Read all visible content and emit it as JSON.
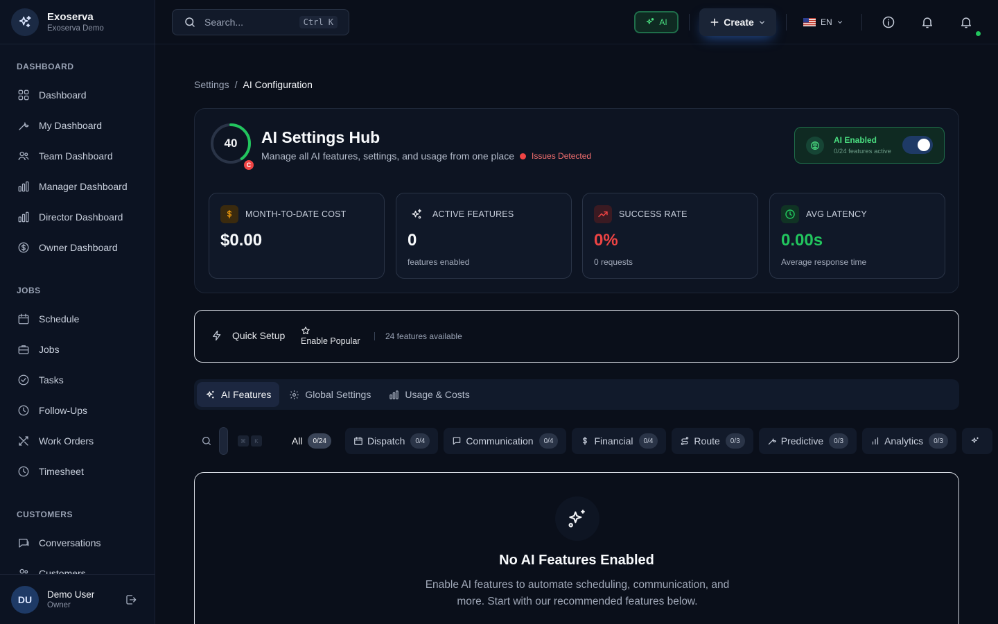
{
  "brand": {
    "name": "Exoserva",
    "subtitle": "Exoserva Demo"
  },
  "sidebar": {
    "sections": [
      {
        "title": "DASHBOARD",
        "items": [
          {
            "label": "Dashboard",
            "icon": "grid-icon"
          },
          {
            "label": "My Dashboard",
            "icon": "wrench-icon"
          },
          {
            "label": "Team Dashboard",
            "icon": "users-icon"
          },
          {
            "label": "Manager Dashboard",
            "icon": "bar-chart-icon"
          },
          {
            "label": "Director Dashboard",
            "icon": "bar-chart-icon"
          },
          {
            "label": "Owner Dashboard",
            "icon": "dollar-circle-icon"
          }
        ]
      },
      {
        "title": "JOBS",
        "items": [
          {
            "label": "Schedule",
            "icon": "calendar-icon"
          },
          {
            "label": "Jobs",
            "icon": "briefcase-icon"
          },
          {
            "label": "Tasks",
            "icon": "check-circle-icon"
          },
          {
            "label": "Follow-Ups",
            "icon": "clock-icon"
          },
          {
            "label": "Work Orders",
            "icon": "tools-icon"
          },
          {
            "label": "Timesheet",
            "icon": "clock-icon"
          }
        ]
      },
      {
        "title": "CUSTOMERS",
        "items": [
          {
            "label": "Conversations",
            "icon": "chat-icon"
          },
          {
            "label": "Customers",
            "icon": "users-icon"
          }
        ]
      }
    ]
  },
  "user": {
    "initials": "DU",
    "name": "Demo User",
    "role": "Owner"
  },
  "topbar": {
    "search_placeholder": "Search...",
    "search_shortcut": "Ctrl K",
    "ai_label": "AI",
    "create_label": "Create",
    "language": "EN"
  },
  "breadcrumb": {
    "parent": "Settings",
    "separator": "/",
    "current": "AI Configuration"
  },
  "hub": {
    "score": 40,
    "score_fraction": 0.4,
    "grade": "C",
    "title": "AI Settings Hub",
    "subtitle": "Manage all AI features, settings, and usage from one place",
    "status": "Issues Detected",
    "ai_enabled_title": "AI Enabled",
    "ai_enabled_sub": "0/24 features active",
    "ai_enabled_on": true
  },
  "stats": [
    {
      "label": "MONTH-TO-DATE COST",
      "value": "$0.00",
      "caption": "",
      "icon": "dollar-icon",
      "color": "#f59e0b"
    },
    {
      "label": "ACTIVE FEATURES",
      "value": "0",
      "caption": "features enabled",
      "icon": "sparkles-icon",
      "color": "#e5e7eb"
    },
    {
      "label": "SUCCESS RATE",
      "value": "0%",
      "caption": "0 requests",
      "icon": "trend-icon",
      "color": "#ef4444"
    },
    {
      "label": "AVG LATENCY",
      "value": "0.00s",
      "caption": "Average response time",
      "icon": "clock-icon",
      "color": "#22c55e"
    }
  ],
  "quick_setup": {
    "label": "Quick Setup",
    "popular": "Enable Popular",
    "available": "24 features available"
  },
  "tabs": [
    {
      "label": "AI Features",
      "active": true
    },
    {
      "label": "Global Settings",
      "active": false
    },
    {
      "label": "Usage & Costs",
      "active": false
    }
  ],
  "filters": {
    "shortcut_keys": [
      "⌘",
      "K"
    ],
    "chips": [
      {
        "label": "All",
        "count": "0/24",
        "active": true
      },
      {
        "label": "Dispatch",
        "count": "0/4"
      },
      {
        "label": "Communication",
        "count": "0/4"
      },
      {
        "label": "Financial",
        "count": "0/4"
      },
      {
        "label": "Route",
        "count": "0/3"
      },
      {
        "label": "Predictive",
        "count": "0/3"
      },
      {
        "label": "Analytics",
        "count": "0/3"
      }
    ]
  },
  "empty_state": {
    "title": "No AI Features Enabled",
    "description": "Enable AI features to automate scheduling, communication, and more. Start with our recommended features below."
  },
  "colors": {
    "accent_green": "#4ade80",
    "danger": "#ef4444",
    "warning": "#f59e0b",
    "background": "#0a0f1a"
  }
}
